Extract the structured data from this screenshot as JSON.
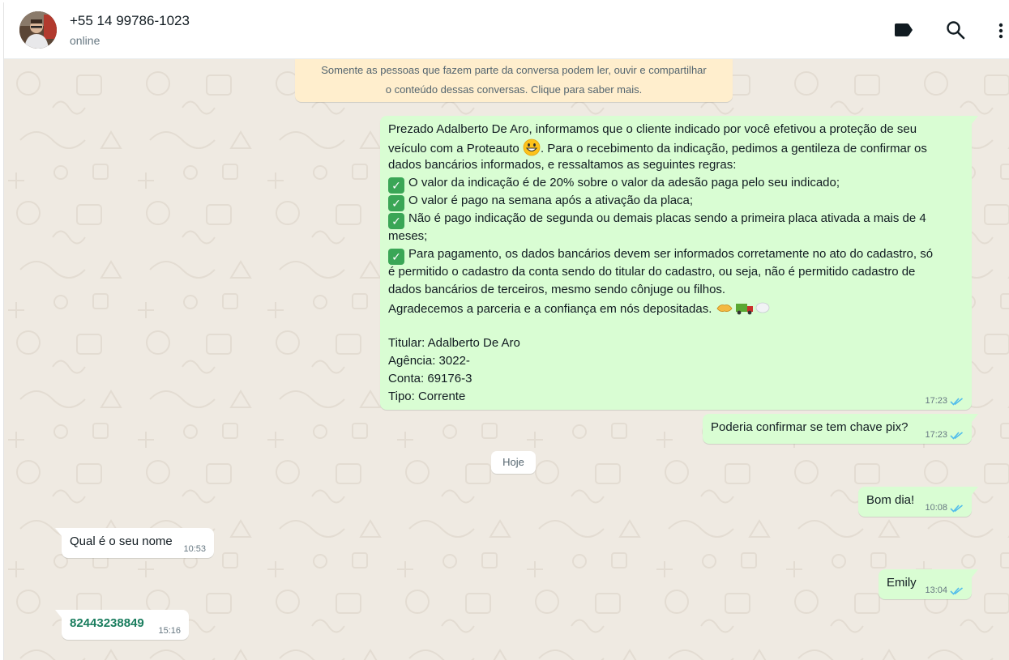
{
  "header": {
    "contact_name": "+55 14 99786-1023",
    "contact_status": "online",
    "icons": [
      "label-icon",
      "search-icon",
      "menu-icon"
    ]
  },
  "notice": {
    "line1": "Somente as pessoas que fazem parte da conversa podem ler, ouvir e compartilhar",
    "line2": "o conteúdo dessas conversas. Clique para saber mais."
  },
  "messages": {
    "m1": {
      "l1": "Prezado Adalberto De Aro, informamos que o cliente indicado por você efetivou a proteção de seu",
      "l2": "veículo com a Proteauto",
      "l2b": ". Para o recebimento da indicação, pedimos a gentileza de confirmar os",
      "l3": "dados bancários informados, e  ressaltamos as seguintes regras:",
      "l4": "O valor da indicação é de 20% sobre o valor da adesão paga pelo seu indicado;",
      "l5": "O valor é pago na semana após a ativação da placa;",
      "l6": "Não é pago indicação de segunda ou demais placas sendo a primeira placa ativada a mais de 4",
      "l7": "meses;",
      "l8": "Para pagamento, os dados bancários devem ser informados corretamente no ato do cadastro, só",
      "l9": "é permitido o cadastro da conta sendo do titular do cadastro, ou seja, não é permitido cadastro de",
      "l10": "dados bancários de terceiros, mesmo sendo cônjuge ou filhos.",
      "l11": "Agradecemos a parceria e a confiança em nós depositadas.",
      "l13": "Titular: Adalberto De Aro",
      "l14": "Agência: 3022-",
      "l15": "Conta: 69176-3",
      "l16": "Tipo: Corrente",
      "time": "17:23"
    },
    "m2": {
      "text": "Poderia confirmar se tem chave pix?",
      "time": "17:23"
    },
    "date_divider": "Hoje",
    "m3": {
      "text": "Bom dia!",
      "time": "10:08"
    },
    "m4": {
      "text": "Qual é o seu nome",
      "time": "10:53"
    },
    "m5": {
      "text": "Emily",
      "time": "13:04"
    },
    "m6": {
      "text": "82443238849",
      "time": "15:16"
    }
  },
  "colors": {
    "outgoing_bubble": "#d9fdd3",
    "incoming_bubble": "#ffffff",
    "chat_background": "#efeae2",
    "notice_background": "#ffeecd",
    "read_ticks": "#53bdeb"
  }
}
